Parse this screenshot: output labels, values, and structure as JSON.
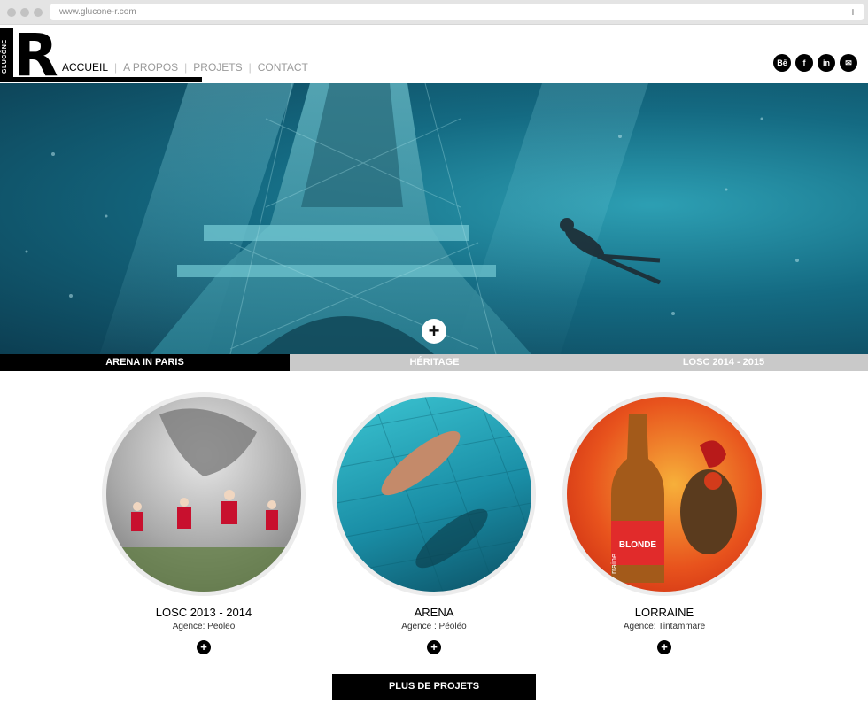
{
  "browser": {
    "url": "www.glucone-r.com",
    "new_tab": "+"
  },
  "header": {
    "logo_side_text": "GLUCÔNE",
    "logo_letter": "R",
    "nav": [
      {
        "label": "ACCUEIL",
        "active": true
      },
      {
        "label": "A PROPOS",
        "active": false
      },
      {
        "label": "PROJETS",
        "active": false
      },
      {
        "label": "CONTACT",
        "active": false
      }
    ],
    "nav_separator": "|",
    "socials": [
      {
        "label": "Bē",
        "icon": "behance-icon"
      },
      {
        "label": "f",
        "icon": "facebook-icon"
      },
      {
        "label": "in",
        "icon": "linkedin-icon"
      },
      {
        "label": "✉",
        "icon": "mail-icon"
      }
    ]
  },
  "hero": {
    "plus": "+"
  },
  "slider_tabs": [
    {
      "label": "ARENA IN PARIS",
      "active": true
    },
    {
      "label": "HÉRITAGE",
      "active": false
    },
    {
      "label": "LOSC 2014 - 2015",
      "active": false
    }
  ],
  "projects": [
    {
      "title": "LOSC 2013 - 2014",
      "agency": "Agence: Peoleo",
      "plus": "+"
    },
    {
      "title": "ARENA",
      "agency": "Agence : Péoléo",
      "plus": "+"
    },
    {
      "title": "LORRAINE",
      "agency": "Agence: Tintammare",
      "plus": "+",
      "bottle_label": "BLONDE",
      "bottle_brand": "rraine"
    }
  ],
  "more_button": "PLUS DE PROJETS",
  "colors": {
    "accent": "#000000",
    "nav_inactive": "#9a9a9a",
    "tab_bg": "#c9c9c9",
    "water": "#146a82"
  }
}
